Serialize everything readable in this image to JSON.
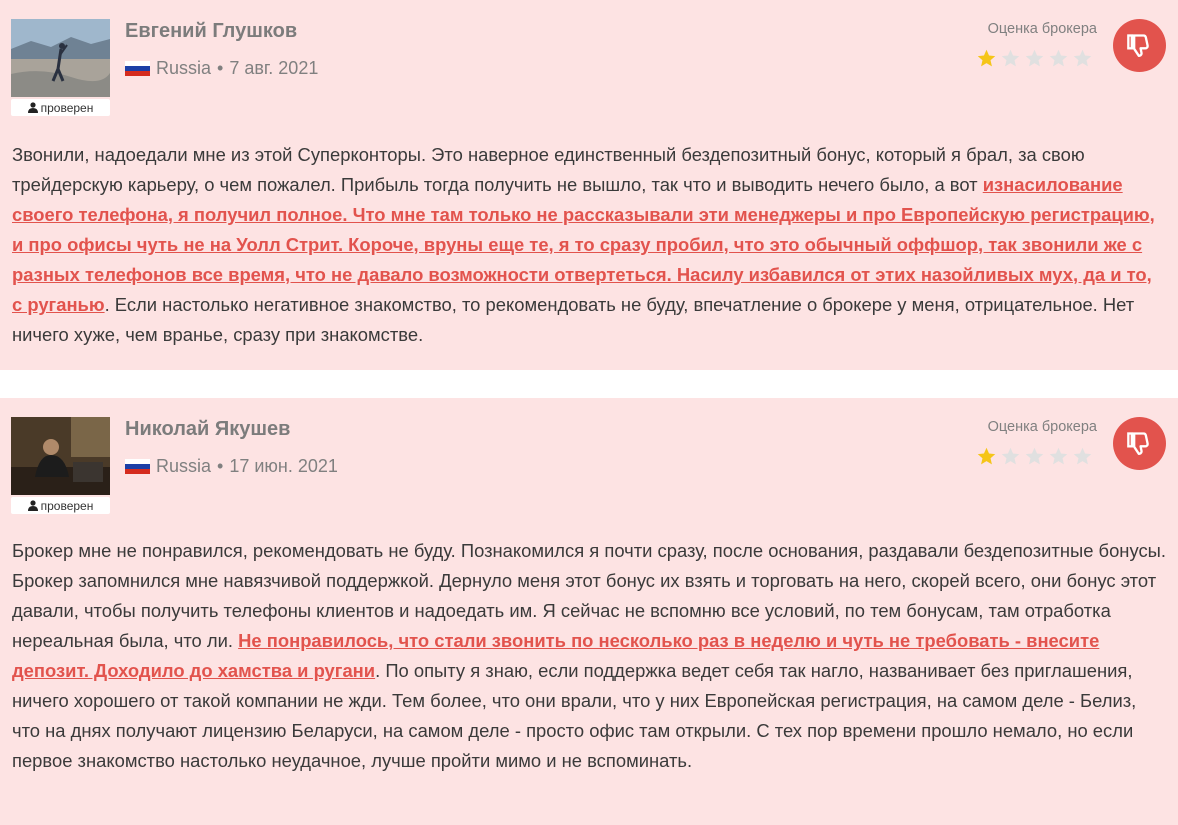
{
  "reviews": [
    {
      "author": "Евгений Глушков",
      "verified_label": "проверен",
      "country": "Russia",
      "separator": "•",
      "date": "7 авг. 2021",
      "rating_label": "Оценка брокера",
      "rating": 1,
      "rating_max": 5,
      "verdict_icon": "thumbs-down-icon",
      "text_before": "Звонили, надоедали мне из этой Суперконторы. Это наверное единственный бездепозитный бонус, который я брал, за свою трейдерскую карьеру, о чем пожалел. Прибыль тогда получить не вышло, так что и выводить нечего было, а вот ",
      "text_highlight": "изнасилование своего телефона, я получил полное. Что мне там только не рассказывали эти менеджеры и про Европейскую регистрацию, и про офисы чуть не на Уолл Стрит. Короче, вруны еще те, я то сразу пробил, что это обычный оффшор, так звонили же с разных телефонов все время, что не давало возможности отвертеться. Насилу избавился от этих назойливых мух, да и то, с руганью",
      "text_after": ". Если настолько негативное знакомство, то рекомендовать не буду, впечатление о брокере у меня, отрицательное. Нет ничего хуже, чем вранье, сразу при знакомстве."
    },
    {
      "author": "Николай Якушев",
      "verified_label": "проверен",
      "country": "Russia",
      "separator": "•",
      "date": "17 июн. 2021",
      "rating_label": "Оценка брокера",
      "rating": 1,
      "rating_max": 5,
      "verdict_icon": "thumbs-down-icon",
      "text_before": "Брокер мне не понравился, рекомендовать не буду. Познакомился я почти сразу, после основания, раздавали бездепозитные бонусы. Брокер запомнился мне навязчивой поддержкой. Дернуло меня этот бонус их взять и торговать на него, скорей всего, они бонус этот давали, чтобы получить телефоны клиентов и надоедать им. Я сейчас не вспомню все условий, по тем бонусам, там отработка нереальная была, что ли. ",
      "text_highlight": "Не понравилось, что стали звонить по несколько раз в неделю и чуть не требовать - внесите депозит. Доходило до хамства и ругани",
      "text_after": ". По опыту я знаю, если поддержка ведет себя так нагло, названивает без приглашения, ничего хорошего от такой компании не жди. Тем более, что они врали, что у них Европейская регистрация, на самом деле - Белиз, что на днях получают лицензию Беларуси, на самом деле - просто офис там открыли. С тех пор времени прошло немало, но если первое знакомство настолько неудачное, лучше пройти мимо и не вспоминать."
    }
  ],
  "colors": {
    "card_bg": "#fde3e3",
    "accent": "#e2534d",
    "star_filled": "#f5c518",
    "star_empty": "#e0e0e0"
  }
}
